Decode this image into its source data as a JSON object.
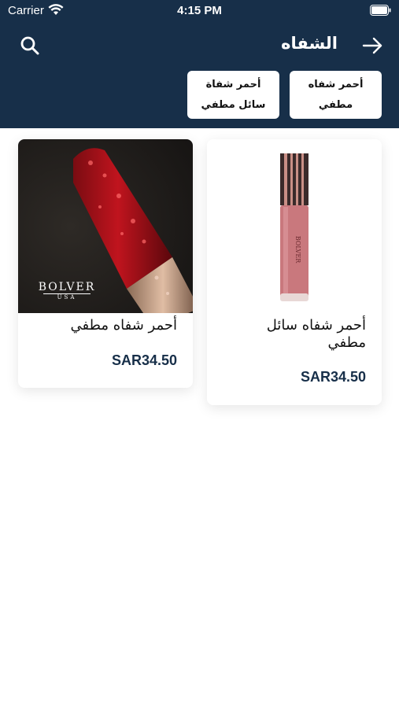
{
  "status_bar": {
    "carrier": "Carrier",
    "time": "4:15 PM"
  },
  "header": {
    "title": "الشفاه",
    "chips": [
      {
        "line1": "أحمر شفاه",
        "line2": "مطفي"
      },
      {
        "line1": "أحمر شفاة",
        "line2": "سائل مطفي"
      }
    ]
  },
  "products": [
    {
      "name_line1": "أحمر شفاه سائل",
      "name_line2": "مطفي",
      "price": "SAR34.50"
    },
    {
      "name_line1": "أحمر شفاه مطفي",
      "name_line2": "",
      "price": "SAR34.50",
      "brand": "BOLVER",
      "brand_sub": "USA"
    }
  ],
  "colors": {
    "header_bg": "#172f49",
    "price": "#172f49"
  }
}
